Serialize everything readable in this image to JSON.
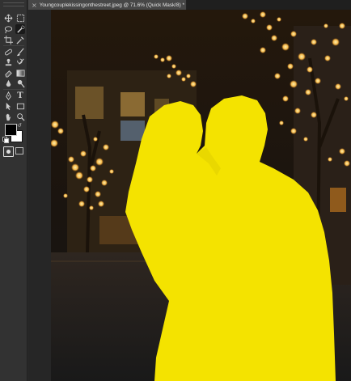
{
  "document": {
    "tab_title": "Youngcouplekissingonthestreet.jpeg @ 71.6% (Quick Mask/8) *",
    "close_glyph": "×",
    "mode": "Quick Mask"
  },
  "toolbar": {
    "tools": [
      {
        "id": "move",
        "icon": "move-icon"
      },
      {
        "id": "marquee",
        "icon": "rect-marquee-icon"
      },
      {
        "id": "lasso",
        "icon": "lasso-icon"
      },
      {
        "id": "quick-selection",
        "icon": "quick-selection-brush-icon",
        "active": true
      },
      {
        "id": "crop",
        "icon": "crop-icon"
      },
      {
        "id": "eyedropper",
        "icon": "eyedropper-icon"
      },
      {
        "id": "healing",
        "icon": "healing-brush-icon"
      },
      {
        "id": "brush",
        "icon": "brush-icon"
      },
      {
        "id": "clone-stamp",
        "icon": "clone-stamp-icon"
      },
      {
        "id": "history-brush",
        "icon": "history-brush-icon"
      },
      {
        "id": "eraser",
        "icon": "eraser-icon"
      },
      {
        "id": "gradient",
        "icon": "gradient-icon"
      },
      {
        "id": "blur",
        "icon": "blur-drop-icon"
      },
      {
        "id": "dodge",
        "icon": "dodge-icon"
      },
      {
        "id": "pen",
        "icon": "pen-icon"
      },
      {
        "id": "type",
        "icon": "type-icon",
        "glyph": "T"
      },
      {
        "id": "path-selection",
        "icon": "path-selection-icon"
      },
      {
        "id": "shape",
        "icon": "rectangle-shape-icon"
      },
      {
        "id": "hand",
        "icon": "hand-icon"
      },
      {
        "id": "zoom",
        "icon": "zoom-icon"
      }
    ],
    "more_glyph": "•••",
    "foreground_color": "#000000",
    "background_color": "#ffffff"
  },
  "colors": {
    "mask_overlay": "#f4e300",
    "panel_bg": "#323232",
    "tab_active_bg": "#474747"
  }
}
